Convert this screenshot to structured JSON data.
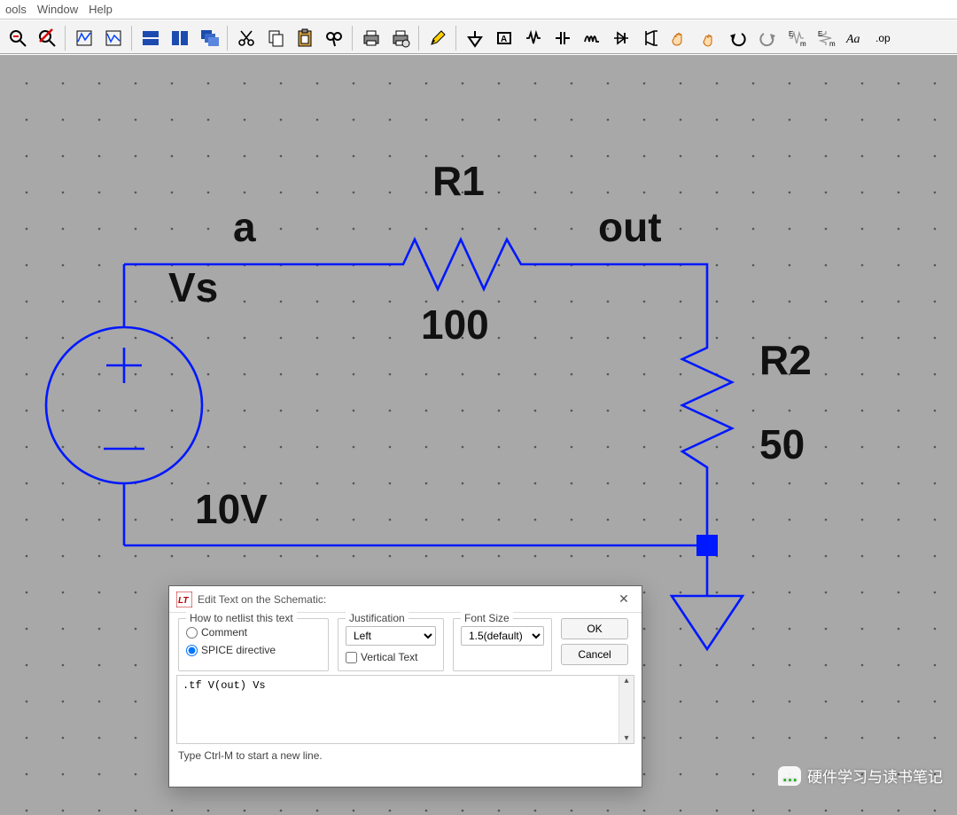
{
  "menubar": {
    "items": [
      "ools",
      "Window",
      "Help"
    ]
  },
  "toolbar_icons": [
    "zoom-out-icon",
    "zoom-cancel-icon",
    "sep",
    "autorange-y-icon",
    "autorange-x-icon",
    "sep",
    "tile-vertical-icon",
    "tile-horizontal-icon",
    "cascade-icon",
    "sep",
    "cut-icon",
    "copy-icon",
    "paste-icon",
    "find-icon",
    "sep",
    "print-icon",
    "print-setup-icon",
    "sep",
    "pencil-icon",
    "sep",
    "ground-icon",
    "label-net-icon",
    "resistor-icon",
    "capacitor-icon",
    "inductor-icon",
    "diode-icon",
    "component-icon",
    "grab-icon",
    "drag-icon",
    "undo-icon",
    "redo-icon",
    "rotate-icon",
    "mirror-icon",
    "text-icon",
    "op-icon"
  ],
  "schematic": {
    "labels": {
      "node_a": "a",
      "node_out": "out",
      "Vs_name": "Vs",
      "Vs_value": "10V",
      "R1_name": "R1",
      "R1_value": "100",
      "R2_name": "R2",
      "R2_value": "50"
    }
  },
  "dialog": {
    "title": "Edit Text on the Schematic:",
    "group1_title": "How to netlist this text",
    "radio_comment": "Comment",
    "radio_spice": "SPICE directive",
    "group2_title": "Justification",
    "justification_value": "Left",
    "vertical_text": "Vertical Text",
    "group3_title": "Font Size",
    "fontsize_value": "1.5(default)",
    "ok": "OK",
    "cancel": "Cancel",
    "text_value": ".tf V(out) Vs",
    "hint": "Type Ctrl-M to start a new line."
  },
  "watermark": "硬件学习与读书笔记"
}
